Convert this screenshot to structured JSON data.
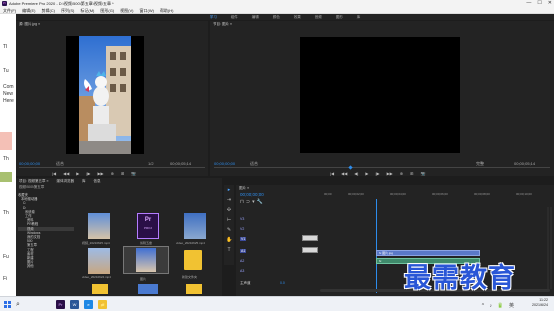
{
  "window": {
    "app_icon": "Pr",
    "title": "Adobe Premiere Pro 2020 - D:\\视频\\500\\第五章\\视频\\五章 *",
    "controls": [
      "—",
      "☐",
      "✕"
    ]
  },
  "menu": [
    "文件(F)",
    "编辑(E)",
    "剪辑(C)",
    "序列(S)",
    "标记(M)",
    "图形(G)",
    "视图(V)",
    "窗口(W)",
    "帮助(H)"
  ],
  "workspaces": [
    "学习",
    "组件",
    "编辑",
    "颜色",
    "效果",
    "音频",
    "图形",
    "库"
  ],
  "workspace_active_index": 0,
  "left_strip": [
    "TI",
    "Tu",
    "Com",
    "New",
    "Here",
    "Th",
    "Th",
    "Fu",
    "Fi"
  ],
  "source_monitor": {
    "tab": "源: 图片.jpg ≡",
    "timecode_in": "00;00;00;00",
    "fit": "适合",
    "ratio": "1/2",
    "timecode_out": "00;00;05;14"
  },
  "program_monitor": {
    "tab": "节目: 图片 ≡",
    "timecode_in": "00;00;00;00",
    "fit": "适合",
    "ratio": "完整",
    "timecode_out": "00;00;05;14"
  },
  "transport_icons": [
    "|◀",
    "◀◀",
    "◀|",
    "▶",
    "|▶",
    "▶▶",
    "⊕",
    "⊞",
    "📷"
  ],
  "project_panel": {
    "tabs": [
      "项目: 视频第五章 ≡",
      "媒体浏览器",
      "库",
      "信息"
    ],
    "path": "视频\\500\\第五章",
    "tree": [
      "收藏夹",
      "本地驱动器",
      "C:",
      "D:",
      "系统卷",
      "工作",
      "资料",
      "PR教程",
      "视频",
      "Windows",
      "我的文档",
      "500",
      "第五章",
      "工程",
      "素材",
      "新建",
      "图片",
      "其他"
    ],
    "items": [
      {
        "caption": "视频_20210625.mp4"
      },
      {
        "caption": "剪辑五章"
      },
      {
        "caption": "video_20210625.mp4"
      },
      {
        "caption": "video_20210624.mp4"
      },
      {
        "caption": "图片"
      },
      {
        "caption": "新建文件夹"
      },
      {
        "caption": "素材"
      }
    ]
  },
  "timeline": {
    "tab": "图片 ≡",
    "timecode": "00;00;00;00",
    "ruler": [
      "00;00",
      "00;00;02;00",
      "00;00;04;00",
      "00;00;06;00",
      "00;00;08;00",
      "00;00;10;00"
    ],
    "tracks": [
      "V3",
      "V2",
      "V1",
      "A1",
      "A2",
      "A3",
      "主声道"
    ],
    "clips": [
      {
        "label": "fx 图片.jpg",
        "track": "V1"
      },
      {
        "label": "fx",
        "track": "A1"
      }
    ],
    "master_value": "0.0"
  },
  "tools": [
    "▸",
    "⇥",
    "✣",
    "⊢",
    "✎",
    "✋",
    "T"
  ],
  "taskbar": {
    "search_icon": "search-icon",
    "apps": [
      "Pr",
      "W",
      "e",
      "📁"
    ],
    "time": "11:22",
    "date": "2021/6/24",
    "lang": "英"
  },
  "watermark": "最需教育",
  "colors": {
    "accent": "#2d8ceb",
    "panel": "#232323",
    "clip": "#5a78c8",
    "watermark": "#2956d6"
  }
}
